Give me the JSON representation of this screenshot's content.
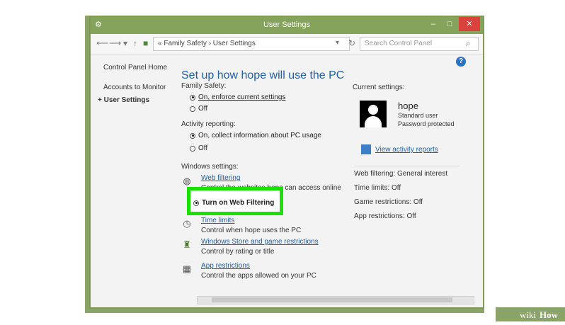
{
  "window": {
    "title": "User Settings",
    "controls": {
      "minimize": "–",
      "maximize": "□",
      "close": "✕"
    }
  },
  "address_bar": {
    "path": "« Family Safety  ›  User Settings",
    "search_placeholder": "Search Control Panel"
  },
  "sidebar": {
    "items": [
      {
        "label": "Control Panel Home"
      },
      {
        "label": "Accounts to Monitor"
      },
      {
        "label": "User Settings",
        "current": true
      }
    ]
  },
  "main": {
    "title": "Set up how hope will use the PC",
    "family_safety": {
      "label": "Family Safety:",
      "options": [
        "On, enforce current settings",
        "Off"
      ],
      "selected": 0
    },
    "activity_reporting": {
      "label": "Activity reporting:",
      "options": [
        "On, collect information about PC usage",
        "Off"
      ],
      "selected": 0
    },
    "windows_settings": {
      "label": "Windows settings:",
      "web_filtering": {
        "link": "Web filtering",
        "description": "Control the websites hope can access online"
      },
      "highlighted_option": "Turn on Web Filtering",
      "time_limits": {
        "link": "Time limits",
        "description": "Control when hope uses the PC"
      },
      "store_restrictions": {
        "link": "Windows Store and game restrictions",
        "description": "Control by rating or title"
      },
      "app_restrictions": {
        "link": "App restrictions",
        "description": "Control the apps allowed on your PC"
      }
    }
  },
  "right_panel": {
    "header": "Current settings:",
    "user": {
      "name": "hope",
      "type": "Standard user",
      "status": "Password protected"
    },
    "view_reports_link": "View activity reports",
    "summary": [
      "Web filtering: General interest",
      "Time limits: Off",
      "Game restrictions: Off",
      "App restrictions: Off"
    ]
  },
  "watermark": "wikiHow",
  "colors": {
    "frame_green": "#8aa366",
    "highlight_green": "#19e000",
    "link_blue": "#1f5fa8"
  }
}
